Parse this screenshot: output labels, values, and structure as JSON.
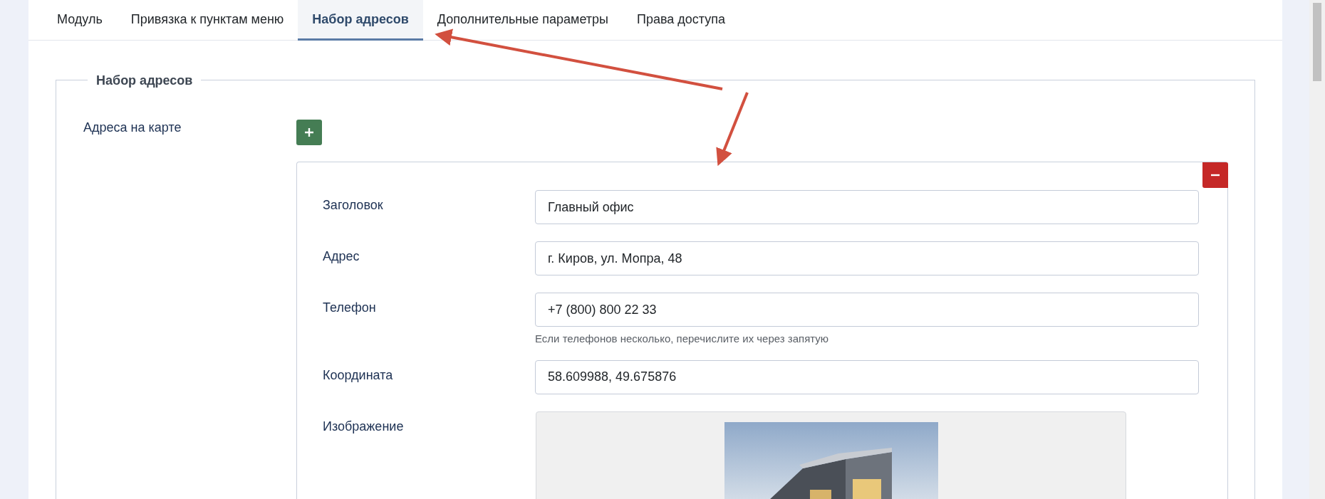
{
  "tabs": [
    {
      "label": "Модуль",
      "selected": false
    },
    {
      "label": "Привязка к пунктам меню",
      "selected": false
    },
    {
      "label": "Набор адресов",
      "selected": true
    },
    {
      "label": "Дополнительные параметры",
      "selected": false
    },
    {
      "label": "Права доступа",
      "selected": false
    }
  ],
  "fieldset": {
    "legend": "Набор адресов",
    "label": "Адреса на карте",
    "entries": [
      {
        "fields": [
          {
            "kind": "text",
            "label": "Заголовок",
            "value": "Главный офис"
          },
          {
            "kind": "text",
            "label": "Адрес",
            "value": "г. Киров, ул. Мопра, 48"
          },
          {
            "kind": "text",
            "label": "Телефон",
            "value": "+7 (800) 800 22 33",
            "hint": "Если телефонов несколько, перечислите их через запятую"
          },
          {
            "kind": "text",
            "label": "Координата",
            "value": "58.609988, 49.675876"
          },
          {
            "label": "Изображение"
          }
        ]
      }
    ]
  }
}
